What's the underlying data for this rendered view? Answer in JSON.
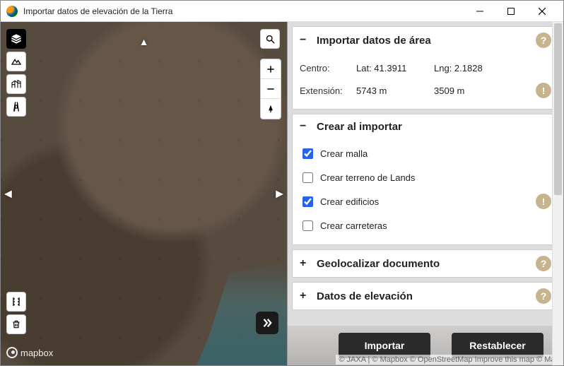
{
  "window": {
    "title": "Importar datos de elevación de la Tierra"
  },
  "sections": {
    "area": {
      "title": "Importar datos de área",
      "center_label": "Centro:",
      "lat_label": "Lat: 41.3911",
      "lng_label": "Lng: 2.1828",
      "extent_label": "Extensión:",
      "extent_w": "5743 m",
      "extent_h": "3509 m"
    },
    "create": {
      "title": "Crear al importar",
      "options": [
        {
          "label": "Crear malla",
          "checked": true
        },
        {
          "label": "Crear terreno de Lands",
          "checked": false
        },
        {
          "label": "Crear edificios",
          "checked": true
        },
        {
          "label": "Crear carreteras",
          "checked": false
        }
      ]
    },
    "geo": {
      "title": "Geolocalizar documento"
    },
    "elev": {
      "title": "Datos de elevación"
    }
  },
  "footer": {
    "import": "Importar",
    "reset": "Restablecer"
  },
  "mapbox": "mapbox",
  "attribution": "© JAXA | © Mapbox © OpenStreetMap Improve this map © Max"
}
